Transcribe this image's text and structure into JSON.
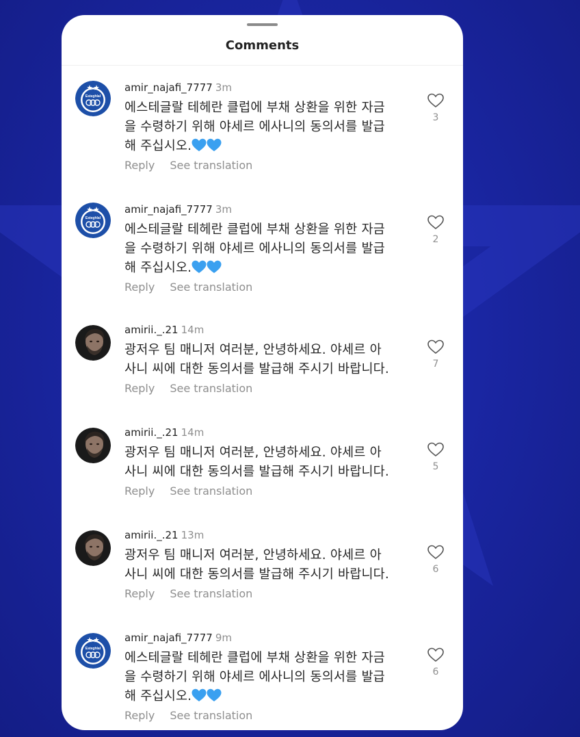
{
  "page": {
    "background": "#1a26a3",
    "accent": "#3aa0f0"
  },
  "sheet": {
    "title": "Comments"
  },
  "comments": [
    {
      "username": "amir_najafi_7777",
      "time": "3m",
      "lines": [
        "에스테글랄 테헤란 클럽에 부채 상환을 위한 자금",
        "을 수령하기 위해 야세르 에사니의 동의서를 발급",
        "해 주십시오."
      ],
      "emoji": "blue-heart-icon",
      "reply_label": "Reply",
      "translate_label": "See translation",
      "likes": "3",
      "avatar": "club-logo-icon"
    },
    {
      "username": "amir_najafi_7777",
      "time": "3m",
      "lines": [
        "에스테글랄 테헤란 클럽에 부채 상환을 위한 자금",
        "을 수령하기 위해 야세르 에사니의 동의서를 발급",
        "해 주십시오."
      ],
      "emoji": "blue-heart-icon",
      "reply_label": "Reply",
      "translate_label": "See translation",
      "likes": "2",
      "avatar": "club-logo-icon"
    },
    {
      "username": "amirii._.21",
      "time": "14m",
      "lines": [
        "광저우 팀 매니저 여러분, 안녕하세요. 야세르 아",
        "사니 씨에 대한 동의서를 발급해 주시기 바랍니다."
      ],
      "reply_label": "Reply",
      "translate_label": "See translation",
      "likes": "7",
      "avatar": "person-avatar-icon"
    },
    {
      "username": "amirii._.21",
      "time": "14m",
      "lines": [
        "광저우 팀 매니저 여러분, 안녕하세요. 야세르 아",
        "사니 씨에 대한 동의서를 발급해 주시기 바랍니다."
      ],
      "reply_label": "Reply",
      "translate_label": "See translation",
      "likes": "5",
      "avatar": "person-avatar-icon"
    },
    {
      "username": "amirii._.21",
      "time": "13m",
      "lines": [
        "광저우 팀 매니저 여러분, 안녕하세요. 야세르 아",
        "사니 씨에 대한 동의서를 발급해 주시기 바랍니다."
      ],
      "reply_label": "Reply",
      "translate_label": "See translation",
      "likes": "6",
      "avatar": "person-avatar-icon"
    },
    {
      "username": "amir_najafi_7777",
      "time": "9m",
      "lines": [
        "에스테글랄 테헤란 클럽에 부채 상환을 위한 자금",
        "을 수령하기 위해 야세르 에사니의 동의서를 발급",
        "해 주십시오."
      ],
      "emoji": "blue-heart-icon",
      "reply_label": "Reply",
      "translate_label": "See translation",
      "likes": "6",
      "avatar": "club-logo-icon"
    }
  ]
}
